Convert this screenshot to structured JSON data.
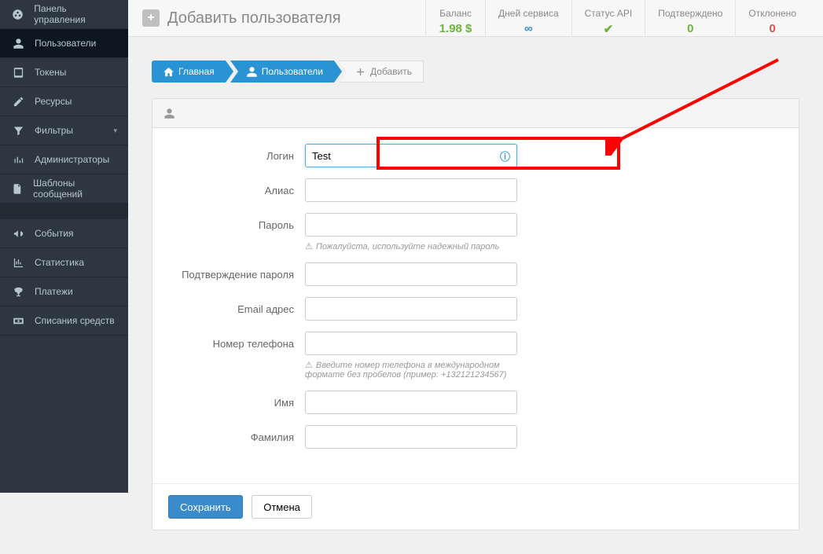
{
  "sidebar": {
    "items": [
      {
        "label": "Панель управления",
        "icon": "dashboard"
      },
      {
        "label": "Пользователи",
        "icon": "user",
        "active": true
      },
      {
        "label": "Токены",
        "icon": "tablet"
      },
      {
        "label": "Ресурсы",
        "icon": "edit"
      },
      {
        "label": "Фильтры",
        "icon": "filter",
        "chev": true
      },
      {
        "label": "Администраторы",
        "icon": "bars"
      },
      {
        "label": "Шаблоны сообщений",
        "icon": "file"
      }
    ],
    "items2": [
      {
        "label": "События",
        "icon": "horn"
      },
      {
        "label": "Статистика",
        "icon": "chart"
      },
      {
        "label": "Платежи",
        "icon": "trophy"
      },
      {
        "label": "Списания средств",
        "icon": "money"
      }
    ]
  },
  "header": {
    "title": "Добавить пользователя",
    "stats": [
      {
        "label": "Баланс",
        "value": "1.98 $",
        "cls": "green"
      },
      {
        "label": "Дней сервиса",
        "value": "∞",
        "cls": "blue"
      },
      {
        "label": "Статус API",
        "value": "✔",
        "cls": "green"
      },
      {
        "label": "Подтверждено",
        "value": "0",
        "cls": "green"
      },
      {
        "label": "Отклонено",
        "value": "0",
        "cls": "red"
      }
    ]
  },
  "crumbs": [
    {
      "label": "Главная",
      "icon": "home"
    },
    {
      "label": "Пользователи",
      "icon": "user"
    },
    {
      "label": "Добавить",
      "icon": "plus",
      "last": true
    }
  ],
  "form": {
    "login": {
      "label": "Логин",
      "value": "Test"
    },
    "alias": {
      "label": "Алиас"
    },
    "password": {
      "label": "Пароль",
      "hint": "Пожалуйста, используйте надежный пароль"
    },
    "passconf": {
      "label": "Подтверждение пароля"
    },
    "email": {
      "label": "Email адрес"
    },
    "phone": {
      "label": "Номер телефона",
      "hint": "Введите номер телефона в международном формате без пробелов (пример: +132121234567)"
    },
    "fname": {
      "label": "Имя"
    },
    "lname": {
      "label": "Фамилия"
    }
  },
  "buttons": {
    "save": "Сохранить",
    "cancel": "Отмена"
  }
}
